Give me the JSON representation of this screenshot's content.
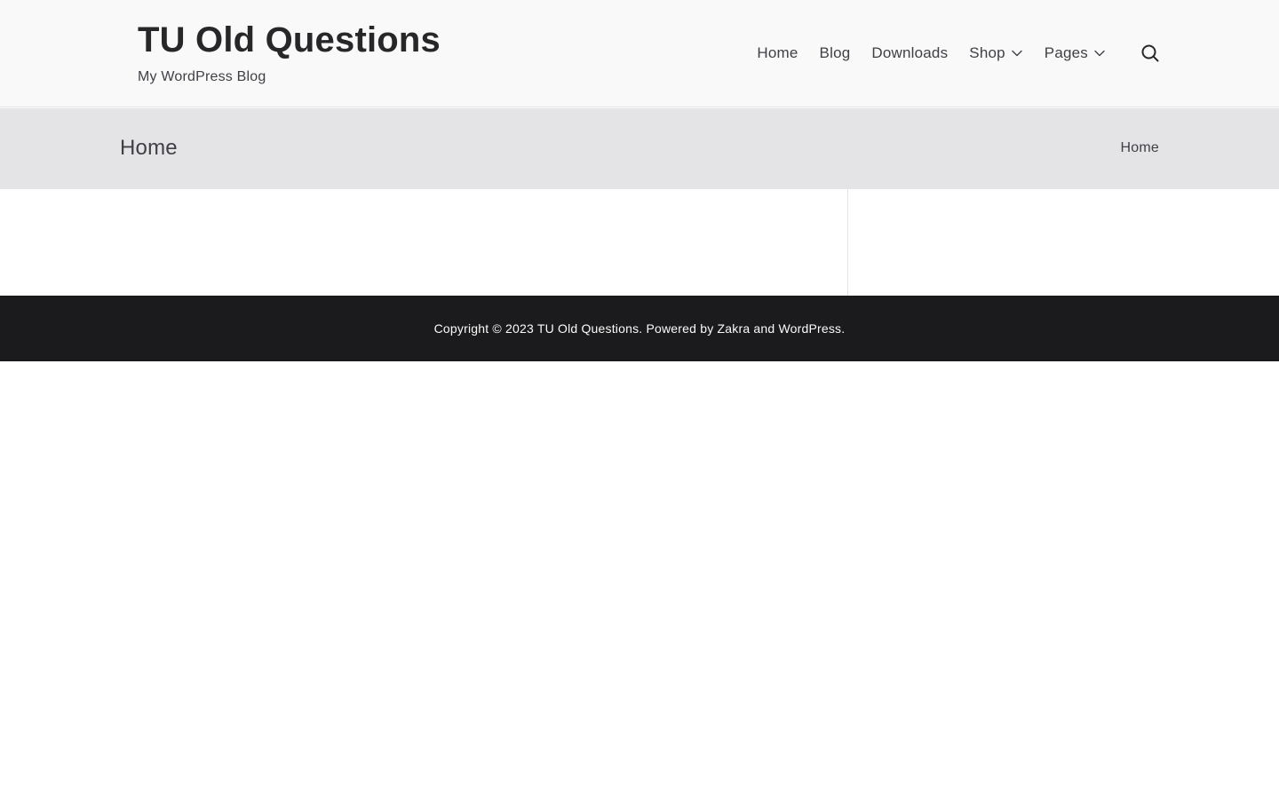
{
  "header": {
    "site_title": "TU Old Questions",
    "tagline": "My WordPress Blog",
    "nav": {
      "home": "Home",
      "blog": "Blog",
      "downloads": "Downloads",
      "shop": "Shop",
      "pages": "Pages"
    },
    "icons": {
      "search": "search-icon",
      "submenu": "chevron-down-icon"
    }
  },
  "page_header": {
    "title": "Home",
    "breadcrumb": "Home"
  },
  "footer": {
    "copyright_prefix": "Copyright © 2023",
    "site_link": "TU Old Questions",
    "powered_by": ". Powered by",
    "theme_link": "Zakra",
    "and": "and",
    "wp_link": "WordPress",
    "end": "."
  },
  "colors": {
    "header_bg": "#f9f9f9",
    "page_header_bg": "#e4e4e7",
    "footer_bg": "#1b1b1d",
    "text": "#3f3f46",
    "title": "#27272a"
  }
}
